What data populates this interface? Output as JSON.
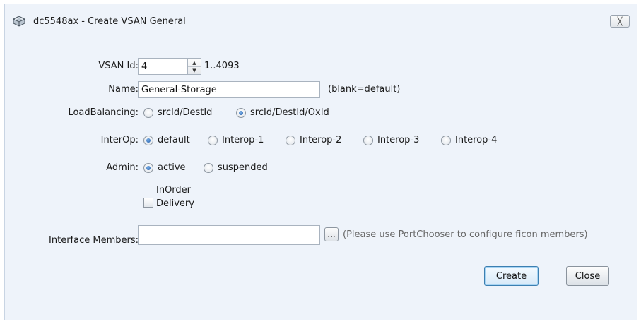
{
  "window": {
    "title": "dc5548ax - Create VSAN General",
    "close_glyph": "╳"
  },
  "vsan_id": {
    "label": "VSAN Id:",
    "value": "4",
    "range": "1..4093"
  },
  "name": {
    "label": "Name:",
    "value": "General-Storage",
    "hint": "(blank=default)"
  },
  "load_balancing": {
    "label": "LoadBalancing:",
    "options": [
      "srcId/DestId",
      "srcId/DestId/OxId"
    ],
    "selected": "srcId/DestId/OxId"
  },
  "interop": {
    "label": "InterOp:",
    "options": [
      "default",
      "Interop-1",
      "Interop-2",
      "Interop-3",
      "Interop-4"
    ],
    "selected": "default"
  },
  "admin": {
    "label": "Admin:",
    "options": [
      "active",
      "suspended"
    ],
    "selected": "active"
  },
  "in_order_delivery": {
    "label_line1": "InOrder",
    "label_line2": "Delivery",
    "checked": false
  },
  "interface_members": {
    "label": "Interface Members:",
    "value": "",
    "browse_label": "...",
    "hint": "(Please use PortChooser to configure ficon members)"
  },
  "buttons": {
    "create": "Create",
    "close": "Close"
  },
  "colors": {
    "dialog_bg": "#eef3fa",
    "radio_selected": "#1e5aa8",
    "primary_button_border": "#3c7fb1"
  }
}
